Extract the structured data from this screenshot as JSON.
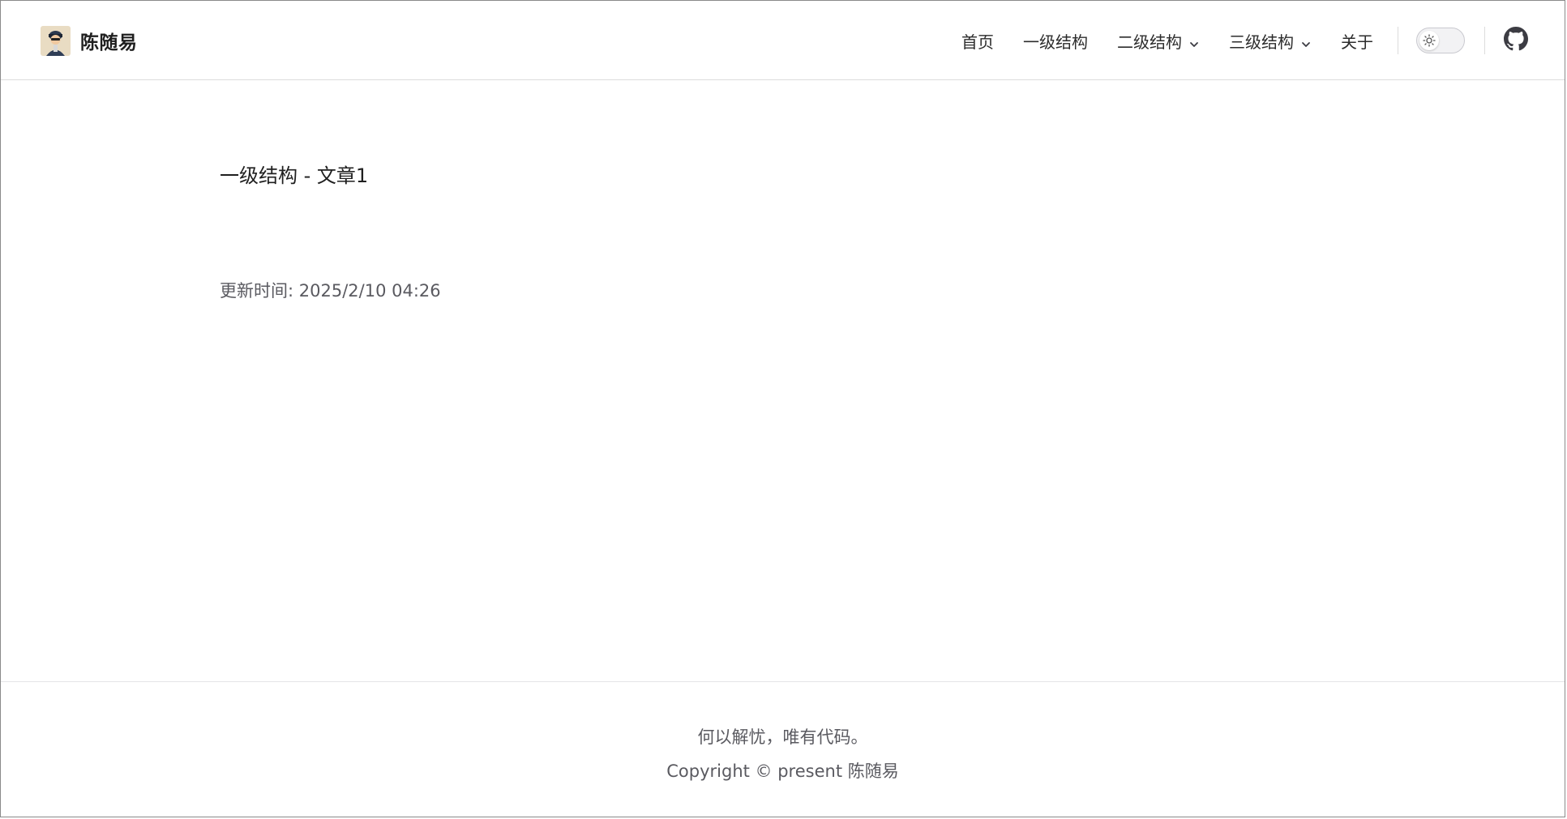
{
  "brand": {
    "title": "陈随易",
    "avatar_icon": "avatar-icon"
  },
  "nav": {
    "items": [
      {
        "label": "首页",
        "dropdown": false
      },
      {
        "label": "一级结构",
        "dropdown": false
      },
      {
        "label": "二级结构",
        "dropdown": true
      },
      {
        "label": "三级结构",
        "dropdown": true
      },
      {
        "label": "关于",
        "dropdown": false
      }
    ],
    "theme_toggle_icon": "sun-icon",
    "github_icon": "github-icon"
  },
  "article": {
    "title": "一级结构 - 文章1",
    "updated_label": "更新时间:",
    "updated_value": "2025/2/10 04:26"
  },
  "footer": {
    "message": "何以解忧，唯有代码。",
    "copyright": "Copyright © present 陈随易"
  },
  "colors": {
    "text": "#3c3c43",
    "border": "#dcdcdc",
    "background": "#ffffff"
  }
}
